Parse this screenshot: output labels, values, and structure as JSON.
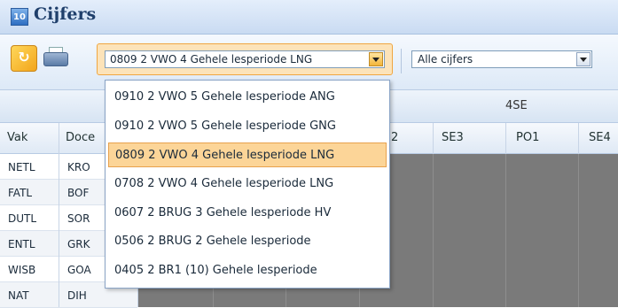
{
  "window": {
    "title": "Cijfers",
    "app_icon_text": "10"
  },
  "toolbar": {
    "period_select": {
      "value": "0809 2 VWO 4 Gehele lesperiode LNG"
    },
    "filter_select": {
      "value": "Alle cijfers"
    }
  },
  "dropdown": {
    "options": [
      "0910 2 VWO 5 Gehele lesperiode ANG",
      "0910 2 VWO 5 Gehele lesperiode GNG",
      "0809 2 VWO 4 Gehele lesperiode LNG",
      "0708 2 VWO 4 Gehele lesperiode LNG",
      "0607 2 BRUG 3 Gehele lesperiode HV",
      "0506 2 BRUG 2 Gehele lesperiode",
      "0405 2 BR1 (10) Gehele lesperiode"
    ],
    "selected_index": 2
  },
  "grid": {
    "group_header": "4SE",
    "columns": {
      "vak": "Vak",
      "docent": "Doce",
      "partial": "2",
      "se3": "SE3",
      "po1": "PO1",
      "se4": "SE4"
    },
    "rows": [
      {
        "vak": "NETL",
        "docent": "KRO"
      },
      {
        "vak": "FATL",
        "docent": "BOF"
      },
      {
        "vak": "DUTL",
        "docent": "SOR"
      },
      {
        "vak": "ENTL",
        "docent": "GRK"
      },
      {
        "vak": "WISB",
        "docent": "GOA"
      },
      {
        "vak": "NAT",
        "docent": "DIH"
      }
    ]
  },
  "colors": {
    "accent": "#f0a640",
    "selected": "#fcd598",
    "grid_bg": "#7a7a7a"
  }
}
